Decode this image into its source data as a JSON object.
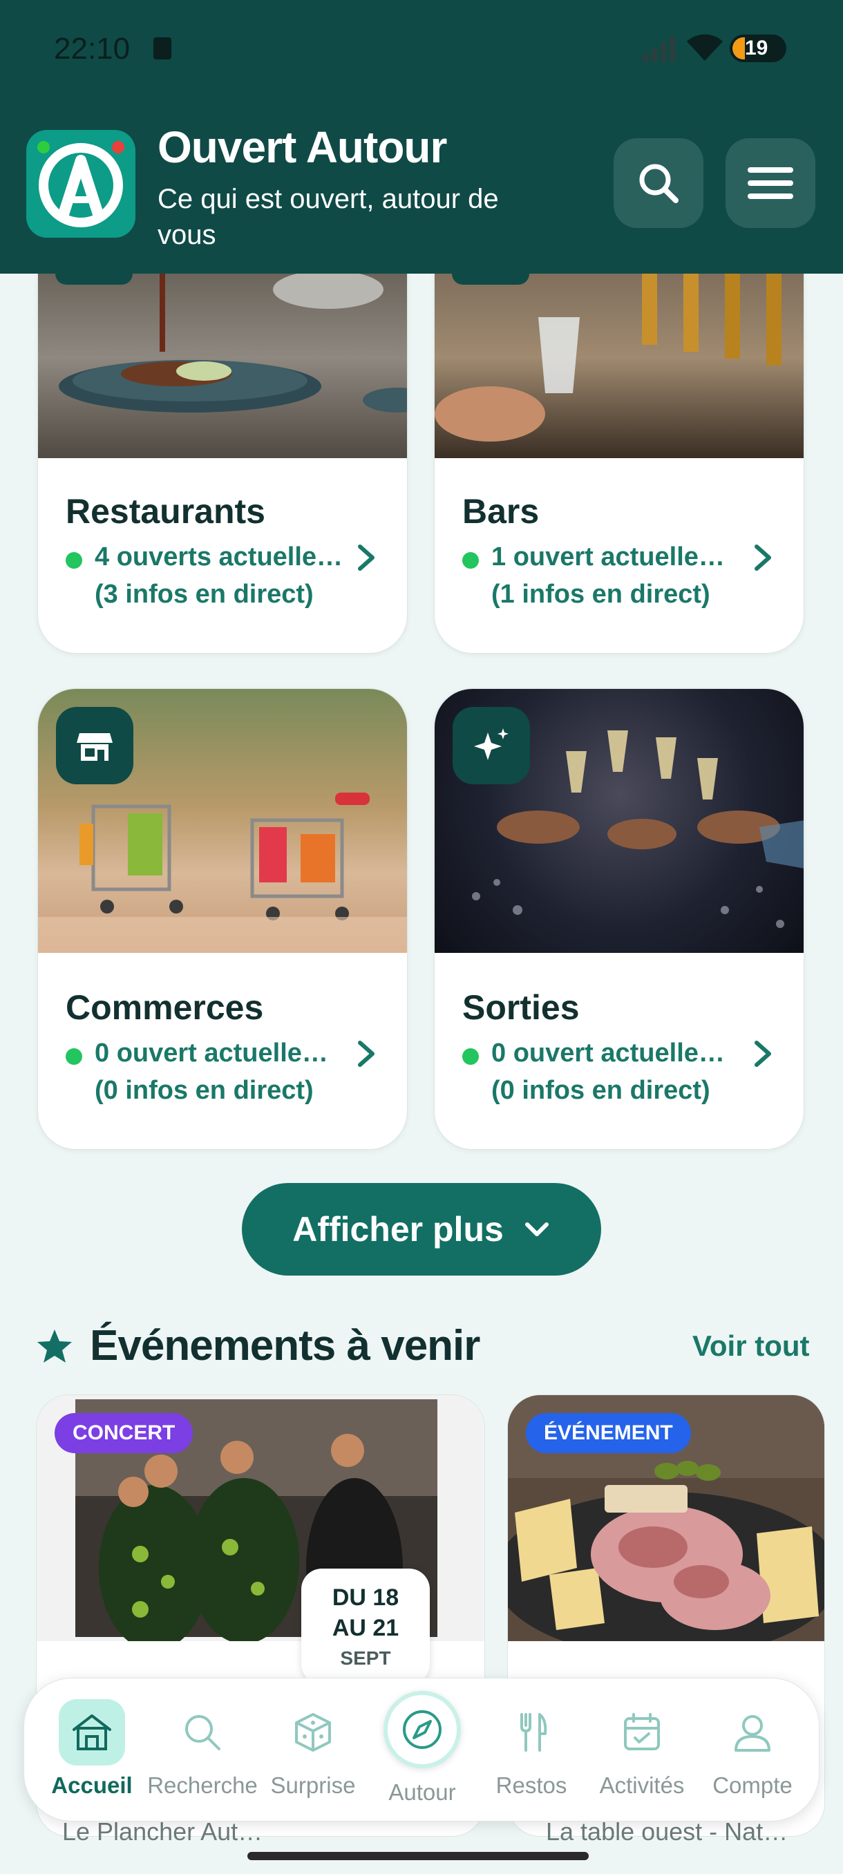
{
  "status_bar": {
    "time": "22:10",
    "battery": "19"
  },
  "header": {
    "title": "Ouvert Autour",
    "subtitle": "Ce qui est ouvert, autour de vous"
  },
  "categories": [
    {
      "name": "Restaurants",
      "open": "4 ouverts actuelle…",
      "live": "(3 infos en direct)",
      "icon": "restaurant-icon"
    },
    {
      "name": "Bars",
      "open": "1 ouvert actuelle…",
      "live": "(1 infos en direct)",
      "icon": "bar-icon"
    },
    {
      "name": "Commerces",
      "open": "0 ouvert actuelle…",
      "live": "(0 infos en direct)",
      "icon": "store-icon"
    },
    {
      "name": "Sorties",
      "open": "0 ouvert actuelle…",
      "live": "(0 infos en direct)",
      "icon": "sparkles-icon"
    }
  ],
  "show_more_label": "Afficher plus",
  "events": {
    "title": "Événements à venir",
    "see_all": "Voir tout",
    "items": [
      {
        "tag": "CONCERT",
        "date_line1": "DU 18",
        "date_line2": "AU 21",
        "date_month": "SEPT",
        "location": "Le Plancher Aut…"
      },
      {
        "tag": "ÉVÉNEMENT",
        "location": "La table ouest - Nat…"
      }
    ]
  },
  "bottom_nav": [
    {
      "label": "Accueil",
      "icon": "home-icon",
      "active": true
    },
    {
      "label": "Recherche",
      "icon": "search-icon",
      "active": false
    },
    {
      "label": "Surprise",
      "icon": "dice-icon",
      "active": false
    },
    {
      "label": "Autour",
      "icon": "compass-icon",
      "active": false
    },
    {
      "label": "Restos",
      "icon": "utensils-icon",
      "active": false
    },
    {
      "label": "Activités",
      "icon": "calendar-icon",
      "active": false
    },
    {
      "label": "Compte",
      "icon": "user-icon",
      "active": false
    }
  ],
  "colors": {
    "header_bg": "#0f4a46",
    "accent": "#136f63",
    "open_dot": "#22c55e",
    "concert_tag": "#7b3fe4",
    "event_tag": "#2563eb"
  }
}
